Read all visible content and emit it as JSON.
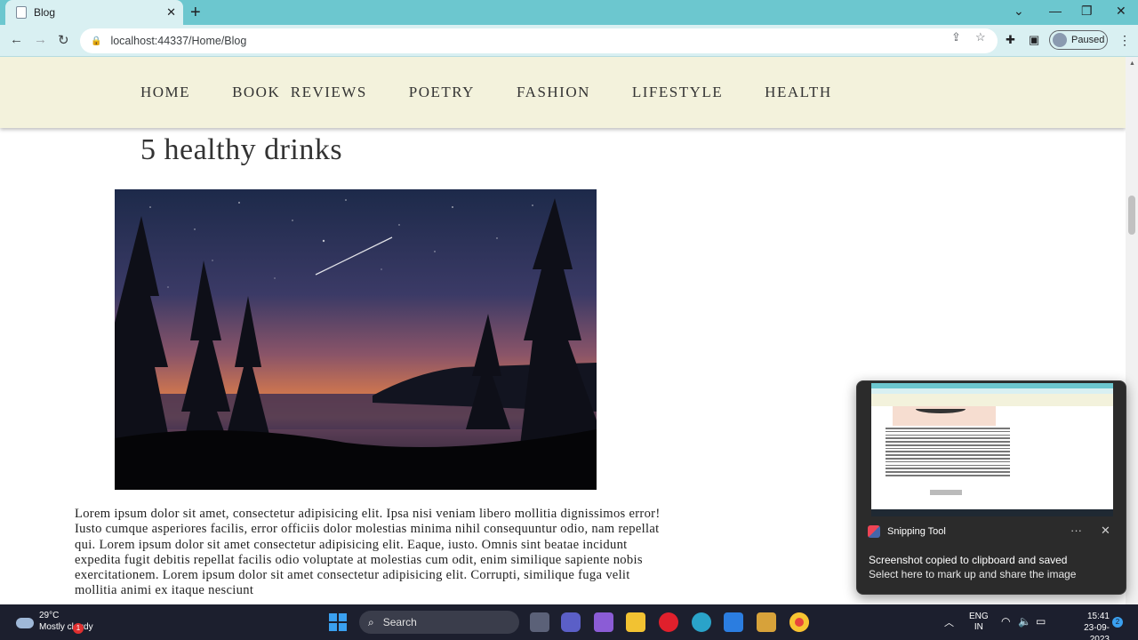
{
  "browser": {
    "tab_title": "Blog",
    "url": "localhost:44337/Home/Blog",
    "profile_status": "Paused"
  },
  "site": {
    "nav": [
      "HOME",
      "BOOK  REVIEWS",
      "POETRY",
      "FASHION",
      "LIFESTYLE",
      "HEALTH"
    ]
  },
  "post": {
    "title": "5 healthy drinks",
    "body": "Lorem ipsum dolor sit amet, consectetur adipisicing elit. Ipsa nisi veniam libero mollitia dignissimos error! Iusto cumque asperiores facilis, error officiis dolor molestias minima nihil consequuntur odio, nam repellat qui. Lorem ipsum dolor sit amet consectetur adipisicing elit. Eaque, iusto. Omnis sint beatae incidunt expedita fugit debitis repellat facilis odio voluptate at molestias cum odit, enim similique sapiente nobis exercitationem. Lorem ipsum dolor sit amet consectetur adipisicing elit. Corrupti, similique fuga velit mollitia animi ex itaque nesciunt"
  },
  "notification": {
    "app_name": "Snipping Tool",
    "line1": "Screenshot copied to clipboard and saved",
    "line2": "Select here to mark up and share the image"
  },
  "taskbar": {
    "weather_temp": "29°C",
    "weather_cond": "Mostly cloudy",
    "weather_badge": "1",
    "search_label": "Search",
    "lang_line1": "ENG",
    "lang_line2": "IN",
    "time": "15:41",
    "date": "23-09-2023",
    "notif_count": "2"
  }
}
